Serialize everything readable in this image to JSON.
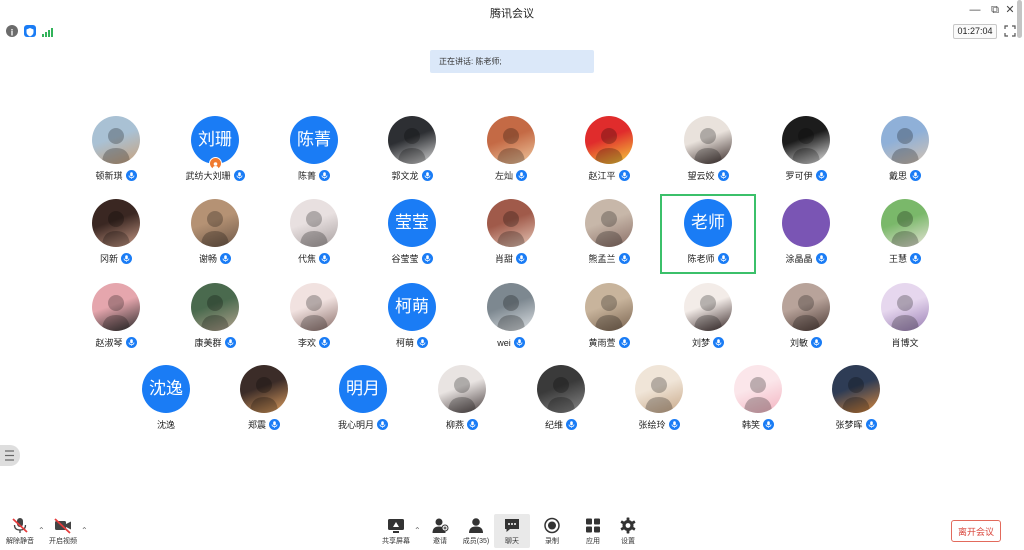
{
  "window": {
    "title": "腾讯会议",
    "minimize_icon": "minimize-icon",
    "restore_icon": "restore-icon",
    "close_icon": "close-icon"
  },
  "status_bar": {
    "icons": [
      "info-icon",
      "shield-icon",
      "signal-icon"
    ],
    "timer": "01:27:04",
    "fullscreen_icon": "fullscreen-icon"
  },
  "speaking": {
    "label": "正在讲话: 陈老师;"
  },
  "participants": [
    {
      "name": "顿新琪"
    },
    {
      "name": "武纺大刘珊",
      "avatar_text": "刘珊",
      "host": true
    },
    {
      "name": "陈菁",
      "avatar_text": "陈菁"
    },
    {
      "name": "郭文龙"
    },
    {
      "name": "左灿"
    },
    {
      "name": "赵江平"
    },
    {
      "name": "望云姣"
    },
    {
      "name": "罗可伊"
    },
    {
      "name": "戴思"
    },
    {
      "name": "冈新"
    },
    {
      "name": "谢畅"
    },
    {
      "name": "代焦"
    },
    {
      "name": "谷莹莹",
      "avatar_text": "莹莹"
    },
    {
      "name": "肖甜"
    },
    {
      "name": "熊孟兰"
    },
    {
      "name": "陈老师",
      "avatar_text": "老师",
      "speaking": true
    },
    {
      "name": "涂晶晶"
    },
    {
      "name": "王慧"
    },
    {
      "name": "赵淑琴"
    },
    {
      "name": "康美群"
    },
    {
      "name": "李欢"
    },
    {
      "name": "柯萌",
      "avatar_text": "柯萌"
    },
    {
      "name": "wei"
    },
    {
      "name": "黄雨萱"
    },
    {
      "name": "刘梦"
    },
    {
      "name": "刘敏"
    },
    {
      "name": "肖博文",
      "mic": false
    },
    {
      "name": "沈逸",
      "avatar_text": "沈逸",
      "mic": false
    },
    {
      "name": "郑震"
    },
    {
      "name": "我心明月",
      "avatar_text": "明月"
    },
    {
      "name": "柳燕"
    },
    {
      "name": "纪维"
    },
    {
      "name": "张绘玲"
    },
    {
      "name": "韩笑"
    },
    {
      "name": "张梦晖"
    }
  ],
  "toolbar": {
    "unmute": "解除静音",
    "start_video": "开启视频",
    "share_screen": "共享屏幕",
    "invite": "邀请",
    "members": "成员(35)",
    "chat": "聊天",
    "record": "录制",
    "apps": "应用",
    "settings": "设置",
    "leave": "离开会议"
  },
  "colors": {
    "accent": "#1a7cf5",
    "speaking_frame": "#3bc06a",
    "leave": "#d9453b",
    "banner": "#dbe8f9"
  }
}
